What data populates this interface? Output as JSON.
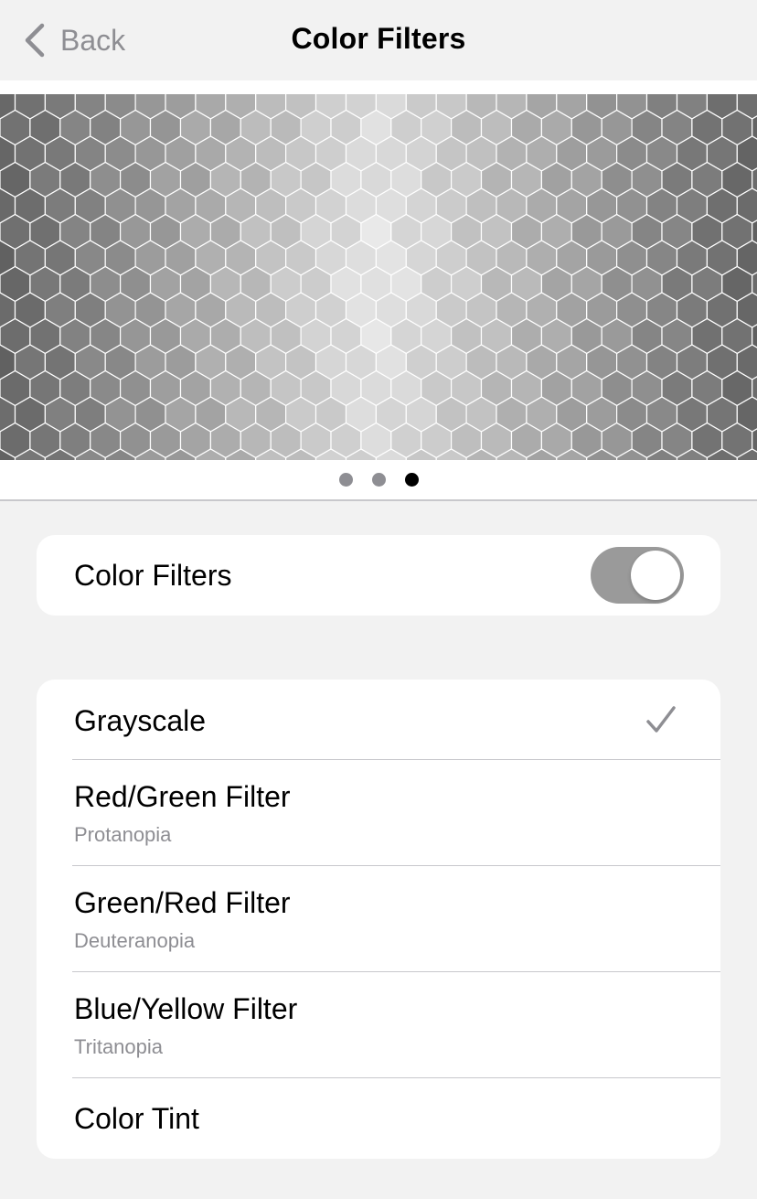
{
  "nav": {
    "back_label": "Back",
    "title": "Color Filters"
  },
  "preview": {
    "icon": "grayscale-hexagon-pattern",
    "page_count": 3,
    "active_page": 3
  },
  "toggle_row": {
    "label": "Color Filters",
    "enabled": true
  },
  "filters": [
    {
      "title": "Grayscale",
      "subtitle": "",
      "selected": true
    },
    {
      "title": "Red/Green Filter",
      "subtitle": "Protanopia",
      "selected": false
    },
    {
      "title": "Green/Red Filter",
      "subtitle": "Deuteranopia",
      "selected": false
    },
    {
      "title": "Blue/Yellow Filter",
      "subtitle": "Tritanopia",
      "selected": false
    },
    {
      "title": "Color Tint",
      "subtitle": "",
      "selected": false
    }
  ],
  "colors": {
    "background": "#f2f2f2",
    "toggle_on": "#9a9a9a",
    "secondary_text": "#8e8e93"
  }
}
